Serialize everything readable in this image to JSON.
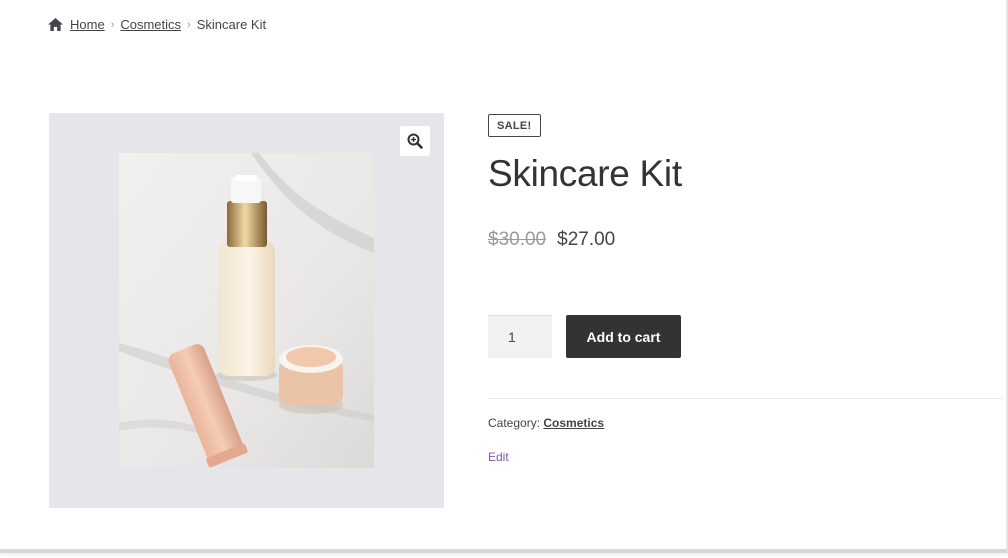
{
  "breadcrumb": {
    "home_icon": "home-icon",
    "items": [
      {
        "label": "Home"
      },
      {
        "label": "Cosmetics"
      },
      {
        "label": "Skincare Kit"
      }
    ],
    "separator": "›"
  },
  "gallery": {
    "zoom_icon": "magnifier-zoom-icon",
    "image_alt": "Skincare kit product photo"
  },
  "product": {
    "badge": "SALE!",
    "title": "Skincare Kit",
    "price_old": "$30.00",
    "price_new": "$27.00",
    "quantity": "1",
    "add_to_cart": "Add to cart",
    "category_label": "Category:",
    "category_value": "Cosmetics",
    "edit_label": "Edit"
  },
  "colors": {
    "button_bg": "#333333",
    "gallery_bg": "#e5e6ea",
    "edit_link": "#7f54b3"
  }
}
